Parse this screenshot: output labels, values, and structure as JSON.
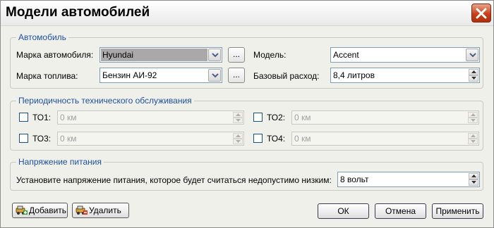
{
  "window": {
    "title": "Модели автомобилей"
  },
  "car_group": {
    "label": "Автомобиль",
    "brand_label": "Марка автомобиля:",
    "brand_value": "Hyundai",
    "brand_browse": "...",
    "fuel_label": "Марка топлива:",
    "fuel_value": "Бензин АИ-92",
    "fuel_browse": "...",
    "model_label": "Модель:",
    "model_value": "Accent",
    "consumption_label": "Базовый расход:",
    "consumption_value": "8,4 литров"
  },
  "maintenance_group": {
    "label": "Периодичность технического обслуживания",
    "to1_label": "ТО1:",
    "to1_value": "0 км",
    "to2_label": "ТО2:",
    "to2_value": "0 км",
    "to3_label": "ТО3:",
    "to3_value": "0 км",
    "to4_label": "ТО4:",
    "to4_value": "0 км"
  },
  "voltage_group": {
    "label": "Напряжение питания",
    "prompt": "Установите напряжение питания, которое будет считаться недопустимо низким:",
    "value": "8 вольт"
  },
  "buttons": {
    "add": "Добавить",
    "delete": "Удалить",
    "ok": "ОК",
    "cancel": "Отмена",
    "apply": "Применить"
  },
  "colors": {
    "group_label": "#1d50a2",
    "window_bg": "#f0f0ea",
    "close_button": "#c9401a"
  }
}
